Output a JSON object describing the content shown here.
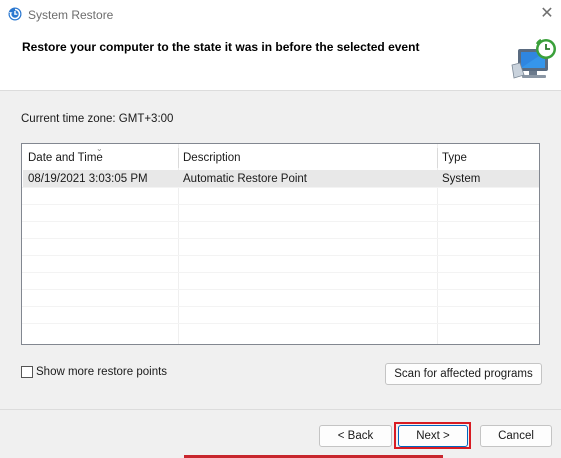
{
  "window": {
    "title": "System Restore",
    "close_glyph": "✕"
  },
  "header": {
    "instruction": "Restore your computer to the state it was in before the selected event",
    "icon": "system-restore-computer-icon"
  },
  "timezone": {
    "text": "Current time zone: GMT+3:00"
  },
  "restore_list": {
    "columns": [
      "Date and Time",
      "Description",
      "Type"
    ],
    "sort_indicator": "⌄",
    "rows": [
      [
        "08/19/2021 3:03:05 PM",
        "Automatic Restore Point",
        "System"
      ]
    ]
  },
  "options": {
    "show_more_label": "Show more restore points",
    "show_more_checked": false
  },
  "buttons": {
    "scan": "Scan for affected programs",
    "back": "< Back",
    "next": "Next >",
    "cancel": "Cancel"
  },
  "colors": {
    "highlight_ring": "#d81b22",
    "default_button_border": "#0067c0"
  }
}
